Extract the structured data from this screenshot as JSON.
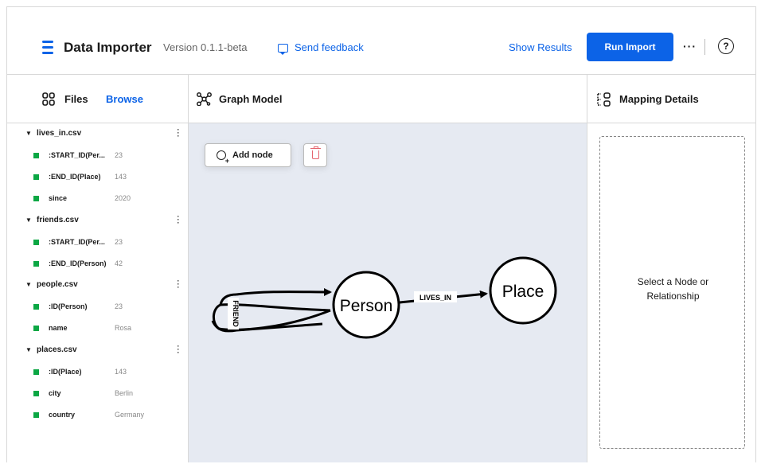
{
  "header": {
    "title": "Data Importer",
    "version": "Version 0.1.1-beta",
    "feedback_label": "Send feedback",
    "show_results_label": "Show Results",
    "run_import_label": "Run Import",
    "more_label": "···",
    "help_label": "?"
  },
  "files_panel": {
    "title": "Files",
    "browse_label": "Browse",
    "files": [
      {
        "name": "lives_in.csv",
        "fields": [
          {
            "name": ":START_ID(Per...",
            "value": "23"
          },
          {
            "name": ":END_ID(Place)",
            "value": "143"
          },
          {
            "name": "since",
            "value": "2020"
          }
        ]
      },
      {
        "name": "friends.csv",
        "fields": [
          {
            "name": ":START_ID(Per...",
            "value": "23"
          },
          {
            "name": ":END_ID(Person)",
            "value": "42"
          }
        ]
      },
      {
        "name": "people.csv",
        "fields": [
          {
            "name": ":ID(Person)",
            "value": "23"
          },
          {
            "name": "name",
            "value": "Rosa"
          }
        ]
      },
      {
        "name": "places.csv",
        "fields": [
          {
            "name": ":ID(Place)",
            "value": "143"
          },
          {
            "name": "city",
            "value": "Berlin"
          },
          {
            "name": "country",
            "value": "Germany"
          }
        ]
      }
    ]
  },
  "graph_panel": {
    "title": "Graph Model",
    "add_node_label": "Add node",
    "nodes": [
      {
        "label": "Person"
      },
      {
        "label": "Place"
      }
    ],
    "relationships": [
      {
        "label": "FRIEND"
      },
      {
        "label": "LIVES_IN"
      }
    ]
  },
  "mapping_panel": {
    "title": "Mapping Details",
    "placeholder_line1": "Select a Node or",
    "placeholder_line2": "Relationship"
  },
  "colors": {
    "accent": "#0c63e7",
    "field_marker": "#0ca744",
    "canvas_bg": "#e6eaf2",
    "delete": "#e5646d"
  }
}
